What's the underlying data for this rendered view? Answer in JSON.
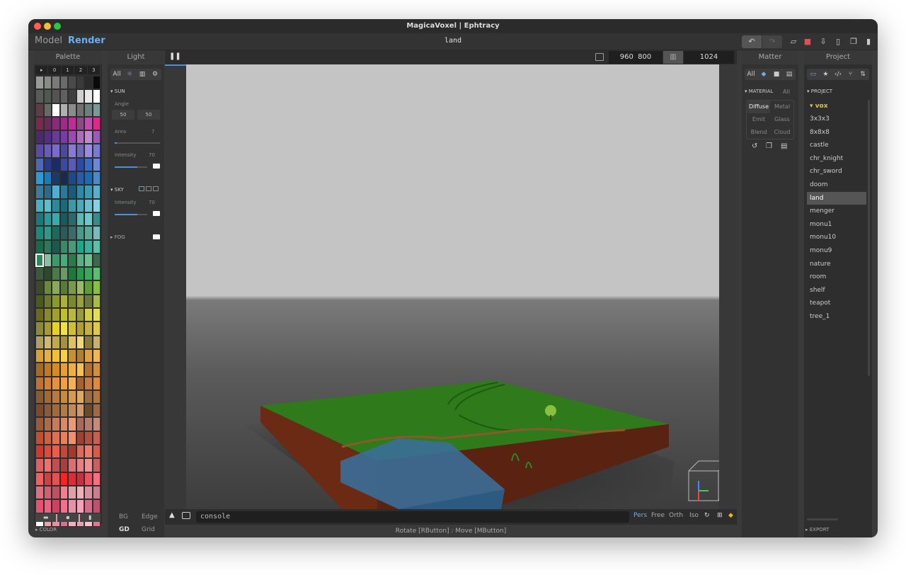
{
  "window": {
    "title": "MagicaVoxel | Ephtracy"
  },
  "menubar": {
    "model_label": "Model",
    "render_label": "Render",
    "filename": "land"
  },
  "toolbar": {
    "undo_icon": "undo-icon",
    "redo_icon": "redo-icon",
    "open_icon": "folder-open-icon",
    "save_icon": "save-icon",
    "save_as_icon": "download-icon",
    "new_icon": "new-file-icon",
    "copy_icon": "copy-icon",
    "delete_icon": "trash-icon"
  },
  "palette": {
    "title": "Palette",
    "tabs": [
      "▸",
      "0",
      "1",
      "2",
      "3"
    ],
    "footer": [
      "▬",
      "▪",
      "▮"
    ],
    "section_label": "▸ COLOR",
    "colors": [
      "#9a9a9a",
      "#8a8a8a",
      "#7a7a7a",
      "#6a6a6a",
      "#4a4a4a",
      "#3a3a3a",
      "#2a2a2a",
      "#0a0a0a",
      "#5a5a5a",
      "#4e5a4e",
      "#545454",
      "#606060",
      "#3e3e3e",
      "#d0d0d0",
      "#e8e8e8",
      "#ffffff",
      "#5c3e48",
      "#686868",
      "#ffffff",
      "#b0b0b0",
      "#8c8c8c",
      "#707070",
      "#6c8080",
      "#7a9a9a",
      "#7a2a4a",
      "#6a2a5a",
      "#8a2a7a",
      "#a02a8a",
      "#c02a9a",
      "#8a4a8a",
      "#c04ab0",
      "#e0288a",
      "#4a2a6a",
      "#5a2a8a",
      "#6a3a9a",
      "#7a3aaa",
      "#9a4ab0",
      "#b06ac0",
      "#c08ad0",
      "#9a5ab8",
      "#5a4aaa",
      "#6a5ac0",
      "#7a6ad0",
      "#4a4a9a",
      "#8a7ad8",
      "#6a6ab8",
      "#9a8ae0",
      "#7a7ad0",
      "#4a6ab8",
      "#2a3a8a",
      "#1a2a6a",
      "#3a4aa0",
      "#5a5ab8",
      "#2a4aa8",
      "#3a6ac8",
      "#6a8ad8",
      "#2a9ad8",
      "#1a7ac0",
      "#1a3a6a",
      "#1a2a4a",
      "#1a4a8a",
      "#2a5aa8",
      "#1a6ab8",
      "#4a8ac8",
      "#3a7a9a",
      "#2a6a8a",
      "#4ab0d8",
      "#2a7a9a",
      "#1a5a7a",
      "#2a8aaa",
      "#3a9ab8",
      "#5ab0c8",
      "#4ab0c0",
      "#5ac0d0",
      "#2a8a9a",
      "#1a6a7a",
      "#3a9aaa",
      "#4aaaba",
      "#6ac0d0",
      "#8ad0e0",
      "#1a7a7a",
      "#2a9a9a",
      "#3aaaaa",
      "#1a5a5a",
      "#2a6a6a",
      "#5ababa",
      "#6acaca",
      "#3a8a8a",
      "#1a8a7a",
      "#2a9a8a",
      "#1a6a5a",
      "#2a5a5a",
      "#3a6a6a",
      "#4a9a8a",
      "#5aaa9a",
      "#7ababa",
      "#1a6a4a",
      "#2a7a5a",
      "#1a5a4a",
      "#3a8a6a",
      "#4a9a7a",
      "#1aaa8a",
      "#3ab09a",
      "#5ac0aa",
      "#2a8a5a",
      "#8ac0a0",
      "#3a9a6a",
      "#4aaa7a",
      "#2a7a4a",
      "#5ab080",
      "#6ac090",
      "#3a6a4a",
      "#3a5a3a",
      "#2a4a2a",
      "#4a7a4a",
      "#6a9a6a",
      "#1a7a3a",
      "#2a9a4a",
      "#3aaa5a",
      "#5ac070",
      "#3a4a2a",
      "#6a8a3a",
      "#8aaa5a",
      "#5a7a3a",
      "#7a9a4a",
      "#9aba6a",
      "#5aa030",
      "#8ac040",
      "#4a5a1a",
      "#6a7a2a",
      "#8a9a2a",
      "#aab03a",
      "#7a8a2a",
      "#9aa03a",
      "#6a7a3a",
      "#aaba4a",
      "#6a6a1a",
      "#8a8a2a",
      "#a0a02a",
      "#c0c02a",
      "#baba3a",
      "#9a9a3a",
      "#d0d040",
      "#e0e050",
      "#8a8a3a",
      "#aa9a2a",
      "#e8d020",
      "#f0e040",
      "#d0c030",
      "#b0a030",
      "#c8b040",
      "#e0c848",
      "#b0a060",
      "#d0b870",
      "#c0a850",
      "#a89040",
      "#e0c060",
      "#f0d878",
      "#8a7a3a",
      "#c8b070",
      "#d8a030",
      "#e8b040",
      "#f0c030",
      "#f8d040",
      "#c89030",
      "#b08030",
      "#e0a040",
      "#f0b850",
      "#a86a20",
      "#c07a20",
      "#d88a20",
      "#e8a030",
      "#f0b040",
      "#f8c050",
      "#b07030",
      "#d09040",
      "#c07030",
      "#d88030",
      "#e89040",
      "#f0a040",
      "#f8b050",
      "#a86030",
      "#c87840",
      "#e08a40",
      "#8a5a30",
      "#a06a30",
      "#b87a40",
      "#c88a40",
      "#d89a50",
      "#e0a860",
      "#9a6a40",
      "#b07840",
      "#7a4a2a",
      "#8a5a3a",
      "#a06a3a",
      "#b07a4a",
      "#c08a5a",
      "#d09a6a",
      "#6a4a2a",
      "#9a6a4a",
      "#9a5a3a",
      "#b06a4a",
      "#c87a5a",
      "#d88a6a",
      "#e89a7a",
      "#a86a5a",
      "#b87a6a",
      "#c88a7a",
      "#c05030",
      "#d06040",
      "#e07050",
      "#e88060",
      "#f09070",
      "#a04030",
      "#b05040",
      "#c86050",
      "#d03a2a",
      "#e04a3a",
      "#f05a4a",
      "#c04a3a",
      "#a03a2a",
      "#e06a5a",
      "#f07a6a",
      "#d85a4a",
      "#e06060",
      "#f07070",
      "#c05050",
      "#a84040",
      "#d87070",
      "#e88080",
      "#f09090",
      "#c86060",
      "#f06060",
      "#d04040",
      "#e85050",
      "#ff2020",
      "#e02a3a",
      "#c83040",
      "#f05060",
      "#f87080",
      "#e07080",
      "#d06070",
      "#c05060",
      "#f08090",
      "#e0a0a8",
      "#f0b0b8",
      "#d890a0",
      "#c88090",
      "#e85070",
      "#f06080",
      "#d04060",
      "#f07090",
      "#e890a8",
      "#f8a0b8",
      "#d86a88",
      "#c05070",
      "#ffffff",
      "#f0a0b0",
      "#e890a0",
      "#d87090",
      "#f0b0c0",
      "#e8a0b8",
      "#f8c0d0",
      "#e07898"
    ],
    "selected_index": 104
  },
  "light": {
    "title": "Light",
    "filters": [
      "All",
      "☼",
      "▥",
      "⚙"
    ],
    "sun": {
      "label": "SUN",
      "angle_label": "Angle",
      "angle_a": "50",
      "angle_b": "50",
      "area_label": "Area",
      "area_value": "7",
      "area_level": 0.05,
      "intensity_label": "Intensity",
      "intensity_value": "70",
      "intensity_level": 0.7
    },
    "sky": {
      "label": "SKY",
      "intensity_label": "Intensity",
      "intensity_value": "70",
      "intensity_level": 0.7
    },
    "fog": {
      "label": "FOG"
    },
    "bg_label": "BG",
    "edge_label": "Edge",
    "gd_label": "GD",
    "grid_label": "Grid"
  },
  "viewport": {
    "pause_icon": "pause-icon",
    "width": "960",
    "height": "800",
    "samples": "1024",
    "render_progress": 0.32,
    "console_text": "console",
    "camera_modes": [
      "Pers",
      "Free",
      "Orth",
      "Iso"
    ],
    "status": "Rotate [RButton] : Move [MButton]"
  },
  "matter": {
    "title": "Matter",
    "filters": [
      "All",
      "◆",
      "■",
      "▤"
    ],
    "material_label": "MATERIAL",
    "material_all": "All",
    "materials": [
      "Diffuse",
      "Metal",
      "Emit",
      "Glass",
      "Blend",
      "Cloud"
    ]
  },
  "project": {
    "title": "Project",
    "section_label": "PROJECT",
    "folder": "vox",
    "items": [
      "3x3x3",
      "8x8x8",
      "castle",
      "chr_knight",
      "chr_sword",
      "doom",
      "land",
      "menger",
      "monu1",
      "monu10",
      "monu9",
      "nature",
      "room",
      "shelf",
      "teapot",
      "tree_1"
    ],
    "selected": "land",
    "export_label": "▸ EXPORT"
  },
  "colors": {
    "accent": "#4a8fd8",
    "vox_folder": "#e8c040",
    "save_red": "#e05050"
  }
}
